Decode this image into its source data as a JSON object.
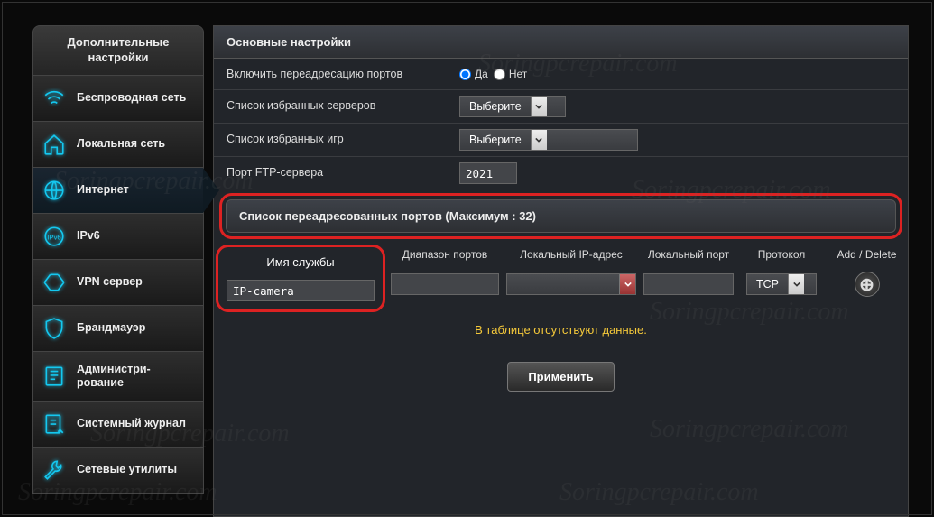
{
  "sidebar": {
    "header": "Дополнительные настройки",
    "items": [
      {
        "label": "Беспроводная сеть",
        "icon": "wifi"
      },
      {
        "label": "Локальная сеть",
        "icon": "home"
      },
      {
        "label": "Интернет",
        "icon": "globe"
      },
      {
        "label": "IPv6",
        "icon": "ipv6"
      },
      {
        "label": "VPN сервер",
        "icon": "vpn"
      },
      {
        "label": "Брандмауэр",
        "icon": "shield"
      },
      {
        "label": "Администри-\nрование",
        "icon": "admin"
      },
      {
        "label": "Системный журнал",
        "icon": "log"
      },
      {
        "label": "Сетевые утилиты",
        "icon": "tools"
      }
    ],
    "activeIndex": 2
  },
  "main": {
    "basicTitle": "Основные настройки",
    "rows": {
      "enable": {
        "label": "Включить переадресацию портов",
        "yes": "Да",
        "no": "Нет",
        "value": "yes"
      },
      "servers": {
        "label": "Список избранных серверов",
        "value": "Выберите"
      },
      "games": {
        "label": "Список избранных игр",
        "value": "Выберите"
      },
      "ftp": {
        "label": "Порт FTP-сервера",
        "value": "2021"
      }
    },
    "portlist": {
      "title": "Список переадресованных портов (Максимум : 32)",
      "headers": {
        "name": "Имя службы",
        "range": "Диапазон портов",
        "ip": "Локальный IP-адрес",
        "port": "Локальный порт",
        "proto": "Протокол",
        "act": "Add / Delete"
      },
      "row": {
        "name": "IP-camera",
        "range": "",
        "ip": "",
        "port": "",
        "proto": "TCP"
      },
      "empty": "В таблице отсутствуют данные."
    },
    "apply": "Применить"
  },
  "watermark": "Soringpcrepair.com"
}
